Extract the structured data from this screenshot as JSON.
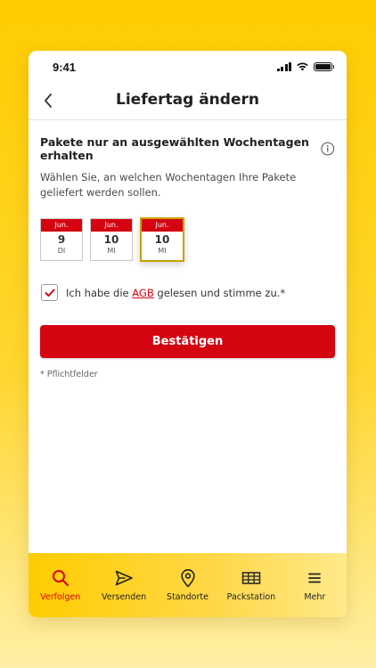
{
  "status_bar": {
    "time": "9:41"
  },
  "header": {
    "title": "Liefertag ändern"
  },
  "section": {
    "title": "Pakete nur an ausgewählten Wochentagen erhalten",
    "description": "Wählen Sie, an welchen Wochentagen Ihre Pakete geliefert werden sollen."
  },
  "days": [
    {
      "month": "Jun.",
      "day": "9",
      "weekday": "DI",
      "selected": false
    },
    {
      "month": "Jun.",
      "day": "10",
      "weekday": "MI",
      "selected": false
    },
    {
      "month": "Jun.",
      "day": "10",
      "weekday": "MI",
      "selected": true
    }
  ],
  "consent": {
    "checked": true,
    "prefix": "Ich habe die ",
    "link": "AGB",
    "suffix": " gelesen und stimme zu.*"
  },
  "confirm_label": "Bestätigen",
  "required_note": "* Pflichtfelder",
  "tabbar": {
    "tabs": [
      {
        "label": "Verfolgen",
        "icon": "search-icon",
        "active": true
      },
      {
        "label": "Versenden",
        "icon": "send-icon",
        "active": false
      },
      {
        "label": "Standorte",
        "icon": "location-pin-icon",
        "active": false
      },
      {
        "label": "Packstation",
        "icon": "packstation-icon",
        "active": false
      },
      {
        "label": "Mehr",
        "icon": "menu-icon",
        "active": false
      }
    ]
  },
  "colors": {
    "brand_red": "#D40511",
    "brand_yellow": "#FFCC00",
    "selected_border": "#C9A200"
  }
}
